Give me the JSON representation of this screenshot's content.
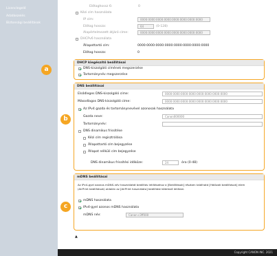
{
  "sidebar": {
    "items": [
      {
        "label": "Licenclegelő"
      },
      {
        "label": "Adatkezelés"
      },
      {
        "label": "Biztonsági beállítások"
      }
    ]
  },
  "top": {
    "elotag": {
      "label": "Előtaghossz 6:",
      "value": "0"
    },
    "manual": {
      "label": "Kézi cím használata"
    },
    "ip": {
      "label": "IP cím:",
      "value": "0000:0000:0000:0000:0000:0000:0000:0000"
    },
    "prefix": {
      "label": "Előtag hossza:",
      "value": "64",
      "hint": "(0-128)"
    },
    "gateway": {
      "label": "Alapértelmezett átjáró címe:",
      "value": "0000:0000:0000:0000:0000:0000:0000:0000"
    },
    "dhcpv6": {
      "label": "DHCPv6 használata"
    },
    "stateful": {
      "label": "Állapottartó cím:",
      "value": "0000:0000:0000:0000:0000:0000:0000:0000"
    },
    "prefix2": {
      "label": "Előtag hossza:",
      "value": "0"
    }
  },
  "dhcp": {
    "title": "DHCP kiegészítő beállításai",
    "opt1": "DNS-kiszolgáló címének megszerzése",
    "opt2": "Tartománynév megszerzése",
    "badge": "a"
  },
  "dns": {
    "title": "DNS beállításai",
    "primary": {
      "label": "Elsődleges DNS-kiszolgáló címe:",
      "value": "0000:0000:0000:0000:0000:0000:0000:0000"
    },
    "secondary": {
      "label": "Másodlagos DNS-kiszolgáló címe:",
      "value": "0000:0000:0000:0000:0000:0000:0000:0000"
    },
    "same_as_ipv4": "Az IPv4 gazda és tartománynevével azonosak használata",
    "host": {
      "label": "Gazda neve:",
      "value": "Canon000000"
    },
    "domain": {
      "label": "Tartománynév:",
      "value": ""
    },
    "dyn": "DNS dinamikus frissítése",
    "manual_reg": "Kézi cím regisztrálása",
    "stateful_reg": "Állapottartó cím bejegyzése",
    "stateless_reg": "Állapot nélküli cím bejegyzése",
    "interval": {
      "label": "DNS dinamikus frissítési időköze:",
      "value": "24",
      "unit": "óra (0-48)"
    },
    "badge": "b"
  },
  "mdns": {
    "title": "mDNS beállításai",
    "desc1": "Az IPv4-gyel azonos mDNS-név használatát beállítás letiltásához a [Beállítások] részben található [Hálózati beállítások] elem",
    "desc2": "(AirPrint beállítások) oldalán az [AirPrint használata] beállítást kötelező letiltani.",
    "use": "mDNS használata",
    "same": "IPv4-gyel azonos mDNS használata",
    "name": {
      "label": "mDNS név:",
      "value": "Canon c3ff000"
    },
    "badge": "c"
  },
  "page_nav": "▲",
  "footer": "Copyright CANON INC. 2021",
  "colors": {
    "accent": "#f5a623",
    "sidebar": "#cdd5de",
    "footer": "#1e1e1e"
  }
}
